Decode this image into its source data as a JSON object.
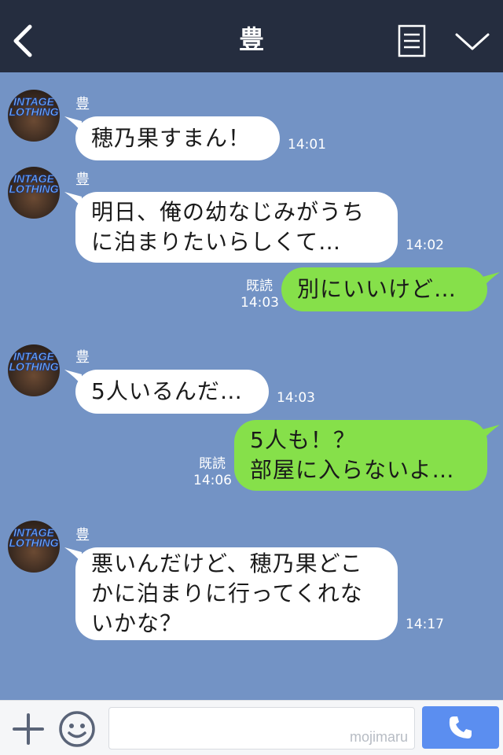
{
  "header": {
    "title": "豊",
    "back_icon": "chevron-left-icon",
    "menu_icon": "note-icon",
    "dropdown_icon": "chevron-down-icon"
  },
  "avatar_text": [
    "INTAGE",
    "LOTHING"
  ],
  "messages": [
    {
      "side": "in",
      "sender": "豊",
      "text": "穂乃果すまん！",
      "time": "14:01"
    },
    {
      "side": "in",
      "sender": "豊",
      "text": "明日、俺の幼なじみがうち\nに泊まりたいらしくて…",
      "time": "14:02"
    },
    {
      "side": "out",
      "text": "別にいいけど…",
      "read": "既読",
      "time": "14:03"
    },
    {
      "side": "in",
      "sender": "豊",
      "text": "5人いるんだ…",
      "time": "14:03"
    },
    {
      "side": "out",
      "text": "5人も！？\n部屋に入らないよ…",
      "read": "既読",
      "time": "14:06"
    },
    {
      "side": "in",
      "sender": "豊",
      "text": "悪いんだけど、穂乃果どこ\nかに泊まりに行ってくれな\nいかな？",
      "time": "14:17"
    }
  ],
  "footer": {
    "plus_icon": "plus-icon",
    "emoji_icon": "smiley-icon",
    "input_value": "",
    "watermark": "mojimaru",
    "call_icon": "phone-icon"
  },
  "colors": {
    "header_bg": "#252d3f",
    "chat_bg": "#7393c5",
    "incoming_bubble": "#ffffff",
    "outgoing_bubble": "#86e04a",
    "call_button": "#5b8ef0"
  }
}
